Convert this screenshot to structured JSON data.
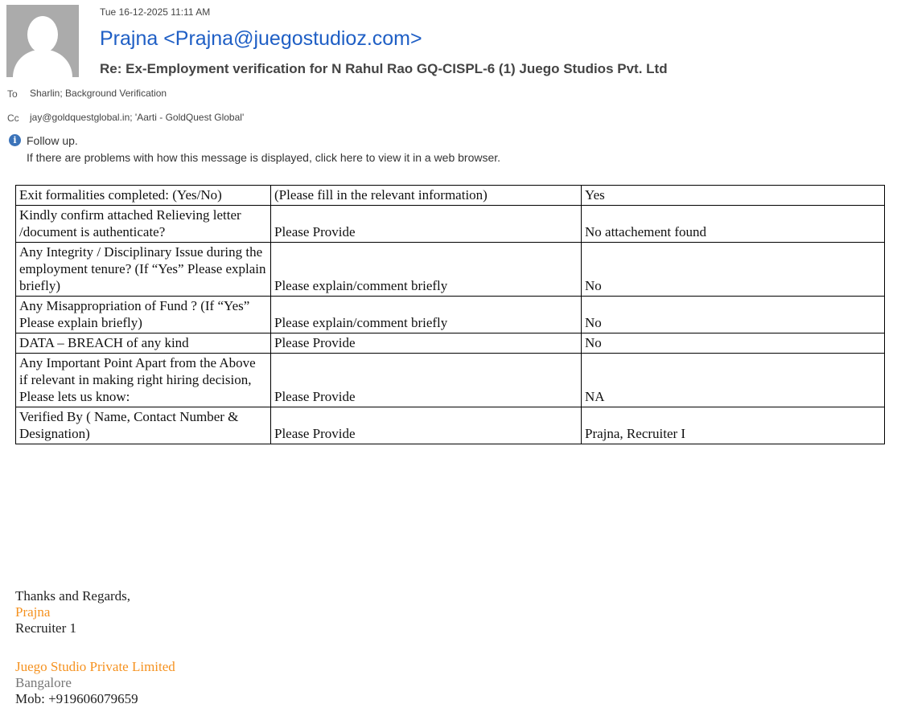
{
  "header": {
    "date": "Tue 16-12-2025 11:11 AM",
    "from": "Prajna <Prajna@juegostudioz.com>",
    "subject": "Re: Ex-Employment verification for N Rahul Rao GQ-CISPL-6 (1) Juego Studios Pvt. Ltd",
    "to_label": "To",
    "to": "Sharlin; Background Verification",
    "cc_label": "Cc",
    "cc": "jay@goldquestglobal.in; 'Aarti - GoldQuest Global'",
    "info_icon": "info-icon",
    "followup": "Follow up.",
    "browser_notice": "If there are problems with how this message is displayed, click here to view it in a web browser."
  },
  "table": {
    "rows": [
      [
        "Exit formalities completed: (Yes/No)",
        "(Please fill in the relevant information)",
        "Yes"
      ],
      [
        "Kindly confirm attached Relieving letter /document is authenticate?",
        "Please Provide",
        "No attachement found"
      ],
      [
        "Any Integrity / Disciplinary Issue during the employment tenure? (If “Yes” Please explain briefly)",
        "Please explain/comment briefly",
        "No"
      ],
      [
        "Any Misappropriation of Fund ? (If “Yes” Please explain briefly)",
        "Please explain/comment briefly",
        "No"
      ],
      [
        "DATA – BREACH of any kind",
        "Please Provide",
        "No"
      ],
      [
        "Any Important Point Apart from the Above if relevant in making right hiring decision, Please lets us know:",
        "Please Provide",
        "NA"
      ],
      [
        "Verified By ( Name, Contact Number & Designation)",
        "Please Provide",
        "Prajna, Recruiter I"
      ]
    ]
  },
  "signature": {
    "closing": "Thanks and Regards,",
    "name": "Prajna",
    "title": "Recruiter 1",
    "company": "Juego Studio Private Limited",
    "city": "Bangalore",
    "mobile": "Mob: +919606079659"
  }
}
